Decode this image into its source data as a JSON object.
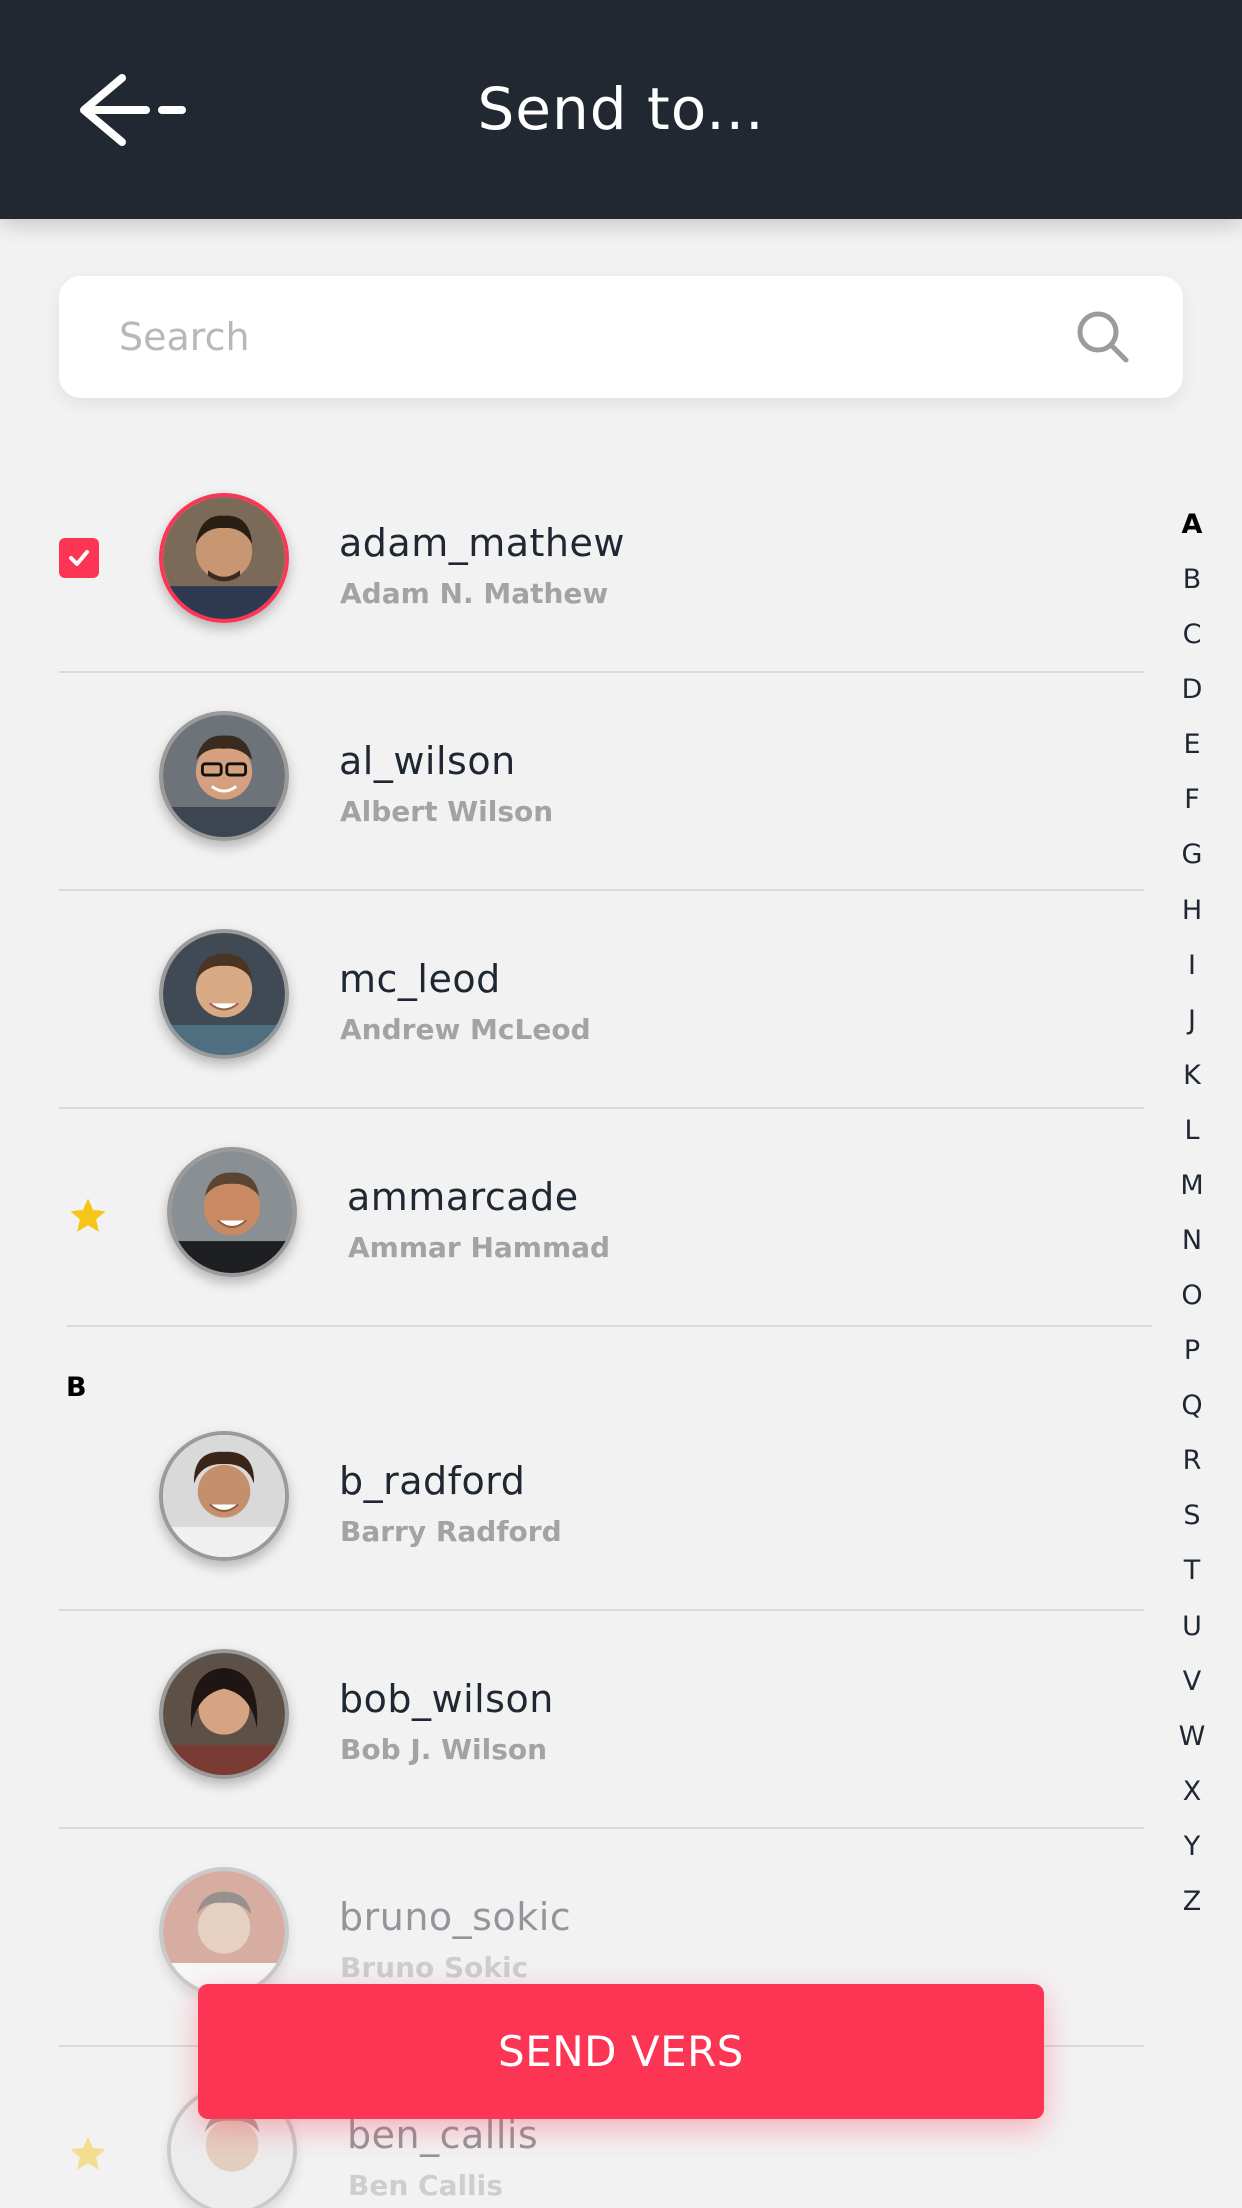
{
  "header": {
    "title": "Send to..."
  },
  "search": {
    "placeholder": "Search"
  },
  "contacts": [
    {
      "username": "adam_mathew",
      "full_name": "Adam N. Mathew",
      "selected": true,
      "favorite": false
    },
    {
      "username": "al_wilson",
      "full_name": "Albert Wilson",
      "selected": false,
      "favorite": false
    },
    {
      "username": "mc_leod",
      "full_name": "Andrew McLeod",
      "selected": false,
      "favorite": false
    },
    {
      "username": "ammarcade",
      "full_name": "Ammar Hammad",
      "selected": false,
      "favorite": true
    },
    {
      "username": "b_radford",
      "full_name": "Barry Radford",
      "selected": false,
      "favorite": false
    },
    {
      "username": "bob_wilson",
      "full_name": "Bob J. Wilson",
      "selected": false,
      "favorite": false
    },
    {
      "username": "bruno_sokic",
      "full_name": "Bruno Sokic",
      "selected": false,
      "favorite": false
    },
    {
      "username": "ben_callis",
      "full_name": "Ben Callis",
      "selected": false,
      "favorite": true
    }
  ],
  "sections": {
    "b": "B"
  },
  "alphabet": {
    "active": "A",
    "letters": [
      "A",
      "B",
      "C",
      "D",
      "E",
      "F",
      "G",
      "H",
      "I",
      "J",
      "K",
      "L",
      "M",
      "N",
      "O",
      "P",
      "Q",
      "R",
      "S",
      "T",
      "U",
      "V",
      "W",
      "X",
      "Y",
      "Z"
    ]
  },
  "send_button": {
    "label": "SEND VERS"
  },
  "colors": {
    "header_bg": "#212831",
    "accent": "#fb3553",
    "star": "#f5c518",
    "page_bg": "#f2f2f2"
  },
  "icons": {
    "back": "arrow-left-icon",
    "search": "search-icon",
    "check": "check-icon",
    "favorite": "star-icon",
    "avatar": "user-photo"
  }
}
